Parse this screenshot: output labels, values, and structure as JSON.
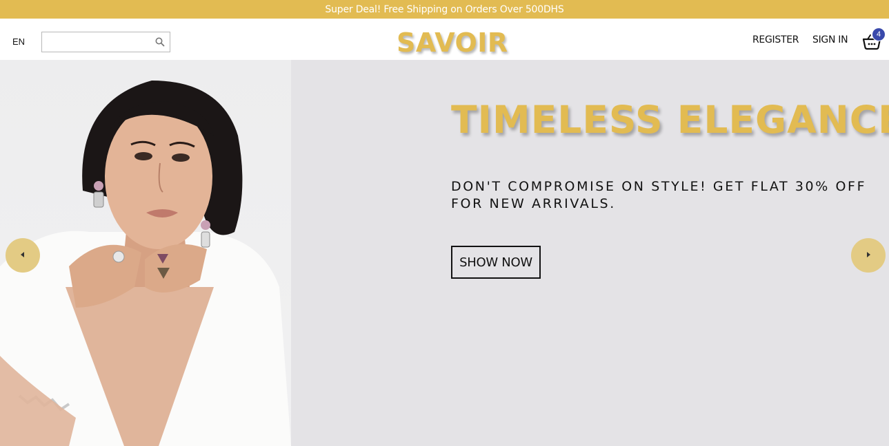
{
  "announcement": {
    "text": "Super Deal! Free Shipping on Orders Over 500DHS"
  },
  "header": {
    "language": "EN",
    "search": {
      "value": "",
      "placeholder": ""
    },
    "logo": "SAVOIR",
    "nav": {
      "register": "REGISTER",
      "signin": "SIGN IN"
    },
    "cart": {
      "count": "4",
      "icon": "basket-icon"
    }
  },
  "hero": {
    "title": "TIMELESS ELEGANCE",
    "subtitle": "DON'T COMPROMISE ON STYLE! GET FLAT 30% OFF FOR NEW ARRIVALS.",
    "cta": "SHOW NOW",
    "prev_icon": "chevron-left-icon",
    "next_icon": "chevron-right-icon"
  },
  "colors": {
    "accent": "#e2bb52",
    "hero_bg": "#e4e3e6",
    "arrow_bg": "#e3cb84",
    "badge": "#3949ab"
  }
}
